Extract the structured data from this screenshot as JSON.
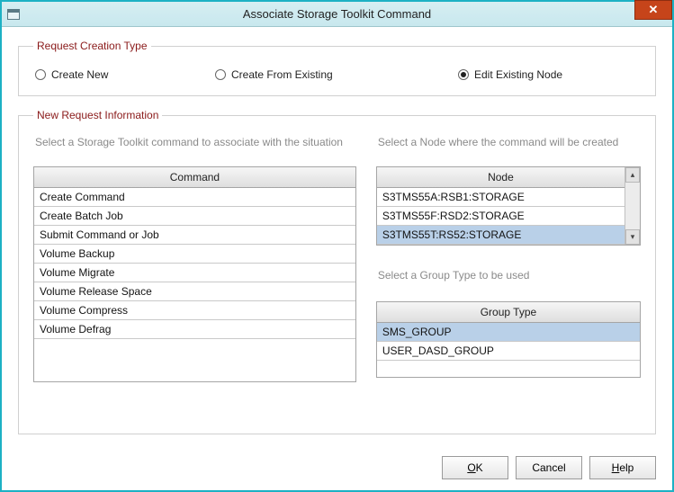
{
  "window": {
    "title": "Associate Storage Toolkit Command",
    "close_glyph": "✕"
  },
  "request_type": {
    "legend": "Request Creation Type",
    "options": [
      {
        "label": "Create New",
        "checked": false
      },
      {
        "label": "Create From Existing",
        "checked": false
      },
      {
        "label": "Edit Existing Node",
        "checked": true
      }
    ]
  },
  "new_request": {
    "legend": "New Request Information",
    "hint_command": "Select a Storage Toolkit command to associate with the situation",
    "hint_node": "Select a Node where the command will be created",
    "hint_group": "Select a Group Type to be used",
    "command_header": "Command",
    "commands": [
      "Create Command",
      "Create Batch Job",
      "Submit Command or Job",
      "Volume Backup",
      "Volume Migrate",
      "Volume Release Space",
      "Volume Compress",
      "Volume Defrag"
    ],
    "node_header": "Node",
    "nodes": [
      {
        "label": "S3TMS55A:RSB1:STORAGE",
        "selected": false
      },
      {
        "label": "S3TMS55F:RSD2:STORAGE",
        "selected": false
      },
      {
        "label": "S3TMS55T:RS52:STORAGE",
        "selected": true
      }
    ],
    "scroll_up": "▴",
    "scroll_down": "▾",
    "grouptype_header": "Group Type",
    "group_types": [
      {
        "label": "SMS_GROUP",
        "selected": true
      },
      {
        "label": "USER_DASD_GROUP",
        "selected": false
      }
    ]
  },
  "buttons": {
    "ok_u": "O",
    "ok_rest": "K",
    "cancel": "Cancel",
    "help_u": "H",
    "help_rest": "elp"
  }
}
